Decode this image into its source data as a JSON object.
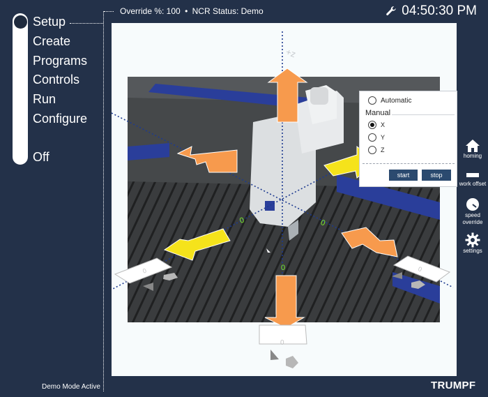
{
  "nav": {
    "items": [
      "Setup",
      "Create",
      "Programs",
      "Controls",
      "Run",
      "Configure"
    ],
    "off_label": "Off"
  },
  "header": {
    "override_text": "Override %: 100",
    "separator": "•",
    "ncr_text": "NCR Status: Demo",
    "clock": "04:50:30 PM"
  },
  "jog": {
    "automatic_label": "Automatic",
    "manual_label": "Manual",
    "axes": [
      "X",
      "Y",
      "Z"
    ],
    "selected_axis": "X",
    "start_label": "start",
    "stop_label": "stop"
  },
  "axes_overlay": {
    "plus_z_label": "+z",
    "zero_marker": "0"
  },
  "tools": [
    {
      "label": "homing",
      "icon": "home-icon"
    },
    {
      "label": "work offset",
      "icon": "work-offset-icon"
    },
    {
      "label": "speed\noverride",
      "icon": "speed-gauge-icon"
    },
    {
      "label": "settings",
      "icon": "gear-icon"
    }
  ],
  "footer": {
    "demo_mode": "Demo Mode Active",
    "brand": "TRUMPF"
  },
  "colors": {
    "background": "#233149",
    "panel": "#f7fbfc",
    "button": "#2b4a6f",
    "arrow_orange": "#f79a4d",
    "arrow_yellow": "#f5e31b",
    "zero_green": "#7ef028"
  }
}
